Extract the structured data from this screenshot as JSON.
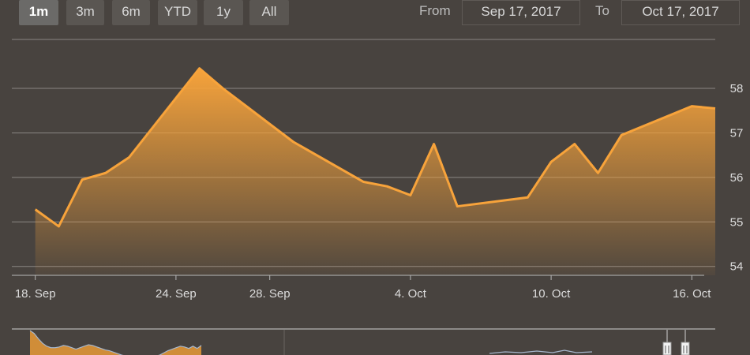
{
  "range_selector": {
    "buttons": [
      {
        "label": "1m",
        "active": true
      },
      {
        "label": "3m",
        "active": false
      },
      {
        "label": "6m",
        "active": false
      },
      {
        "label": "YTD",
        "active": false
      },
      {
        "label": "1y",
        "active": false
      },
      {
        "label": "All",
        "active": false
      }
    ],
    "from_label": "From",
    "from_value": "Sep 17, 2017",
    "to_label": "To",
    "to_value": "Oct 17, 2017"
  },
  "colors": {
    "background": "#48433f",
    "series_line": "#f7a33b",
    "area_top": "#f7a33b",
    "grid": "#8a8683",
    "navigator_fill": "#e99a37",
    "navigator_line": "#a6b6cc"
  },
  "chart_data": {
    "type": "area",
    "x_tick_labels": [
      "18. Sep",
      "24. Sep",
      "28. Sep",
      "4. Oct",
      "10. Oct",
      "16. Oct"
    ],
    "x_tick_dates": [
      "2017-09-18",
      "2017-09-24",
      "2017-09-28",
      "2017-10-04",
      "2017-10-10",
      "2017-10-16"
    ],
    "y_ticks": [
      54,
      55,
      56,
      57,
      58
    ],
    "ylim": [
      53.8,
      59.1
    ],
    "xlim": [
      "2017-09-17",
      "2017-10-17"
    ],
    "grid": true,
    "y_axis_side": "right",
    "series": [
      {
        "x": [
          "2017-09-18",
          "2017-09-19",
          "2017-09-20",
          "2017-09-21",
          "2017-09-22",
          "2017-09-25",
          "2017-09-26",
          "2017-09-27",
          "2017-09-28",
          "2017-09-29",
          "2017-10-02",
          "2017-10-03",
          "2017-10-04",
          "2017-10-05",
          "2017-10-06",
          "2017-10-09",
          "2017-10-10",
          "2017-10-11",
          "2017-10-12",
          "2017-10-13",
          "2017-10-16",
          "2017-10-17"
        ],
        "values": [
          55.28,
          54.9,
          55.95,
          56.1,
          56.45,
          58.45,
          58.0,
          57.6,
          57.2,
          56.8,
          55.9,
          55.8,
          55.6,
          56.75,
          55.35,
          55.55,
          56.35,
          56.75,
          56.1,
          56.95,
          57.6,
          57.55
        ]
      }
    ]
  },
  "navigator": {
    "series": [
      58.3,
      57.9,
      57.2,
      56.6,
      56.2,
      56.0,
      56.0,
      56.1,
      56.3,
      56.2,
      56.0,
      55.8,
      56.0,
      56.2,
      56.4,
      56.3,
      56.1,
      55.9,
      55.7,
      55.6,
      55.4,
      55.2,
      55.0,
      54.9,
      54.8,
      54.8,
      54.8,
      54.8,
      54.8,
      54.8,
      54.9,
      55.0,
      55.3,
      55.6,
      55.8,
      56.0,
      56.2,
      56.1,
      55.9,
      56.2,
      55.9,
      56.3
    ]
  }
}
